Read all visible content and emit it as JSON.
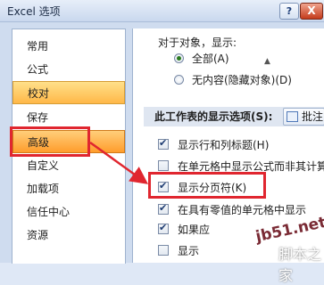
{
  "window": {
    "title": "Excel 选项",
    "help": "?",
    "close": "X"
  },
  "sidebar": {
    "items": [
      {
        "label": "常用"
      },
      {
        "label": "公式"
      },
      {
        "label": "校对"
      },
      {
        "label": "保存"
      },
      {
        "label": "高级"
      },
      {
        "label": "自定义"
      },
      {
        "label": "加载项"
      },
      {
        "label": "信任中心"
      },
      {
        "label": "资源"
      }
    ]
  },
  "main": {
    "objects_heading": "对于对象，显示:",
    "radio_all": "全部(A)",
    "radio_none": "无内容(隐藏对象)(D)",
    "section_title": "此工作表的显示选项(S):",
    "sheet_button": "批注",
    "options": [
      {
        "label": "显示行和列标题(H)",
        "checked": true
      },
      {
        "label": "在单元格中显示公式而非其计算",
        "checked": false
      },
      {
        "label": "显示分页符(K)",
        "checked": true
      },
      {
        "label": "在具有零值的单元格中显示",
        "checked": true
      },
      {
        "label": "如果应",
        "checked": true
      },
      {
        "label": "显示",
        "checked": false
      }
    ]
  },
  "watermark": {
    "line1": "jb51.net",
    "line2": "脚本之家"
  },
  "colors": {
    "highlight": "#e0262f",
    "selected": "#ffb848"
  }
}
